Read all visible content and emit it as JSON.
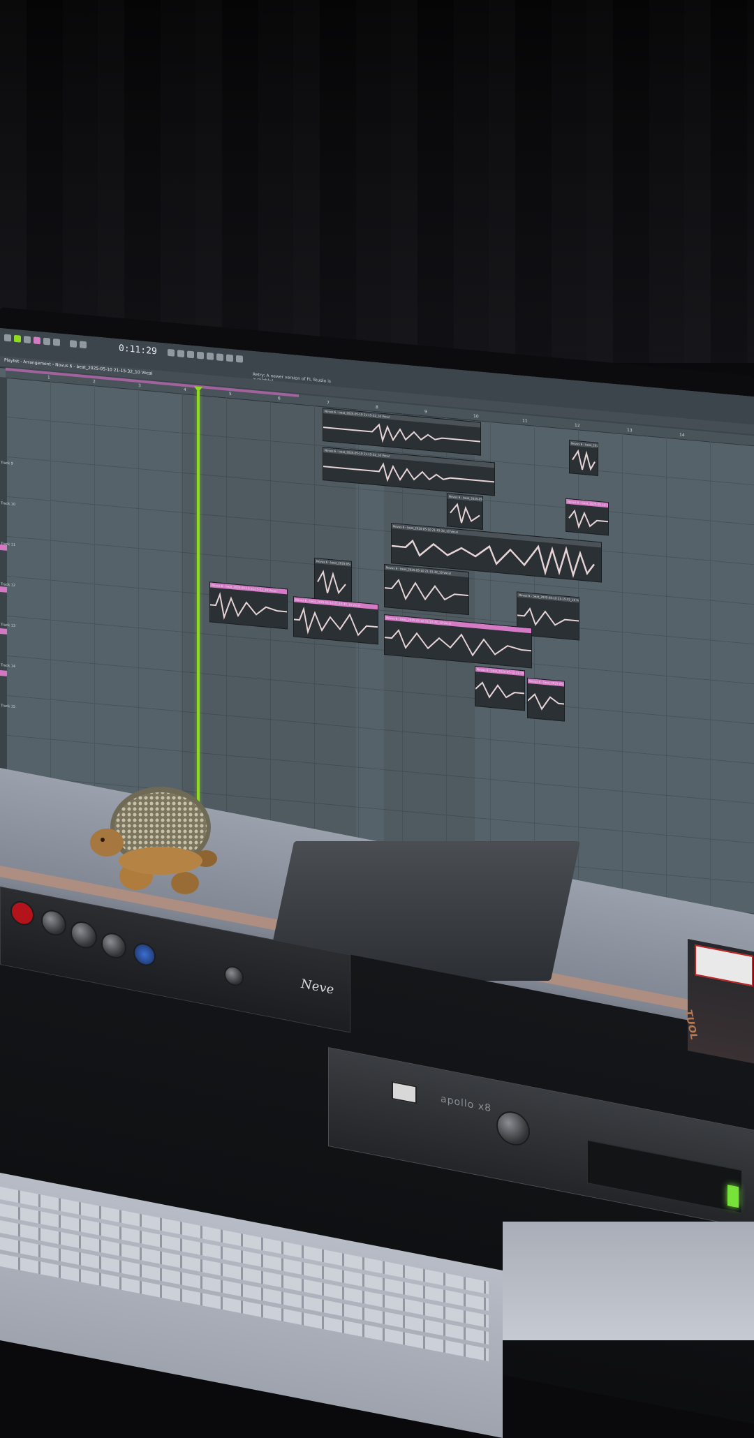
{
  "scene": "photo of a music studio desk with a curved monitor showing a DAW arrangement",
  "daw": {
    "time": "0:11:29",
    "breadcrumb": "Playlist - Arrangement › Novus 6 - beat_2025-05-10 21-15-32_10 Vocal",
    "info_text": "Retry: A newer version of FL Studio is available!",
    "ruler_ticks": [
      "1",
      "2",
      "3",
      "4",
      "5",
      "6",
      "7",
      "8",
      "9",
      "10",
      "11",
      "12",
      "13",
      "14"
    ],
    "track_labels": [
      "Track 9",
      "Track 10",
      "Track 11",
      "Track 12",
      "Track 13",
      "Track 14",
      "Track 15"
    ],
    "clip_title": "Novus 6 - beat_2025-05-10 21-15-32_10 Vocal"
  },
  "hardware": {
    "preamp_brand": "Neve",
    "interface_brand": "apollo x8"
  },
  "box_label": "TUOL",
  "colors": {
    "playhead": "#8fdc1f",
    "clip_pink": "#d57bc6",
    "grid": "#56626a"
  },
  "icons": [
    "turtle-figurine",
    "ua-logo-icon"
  ]
}
